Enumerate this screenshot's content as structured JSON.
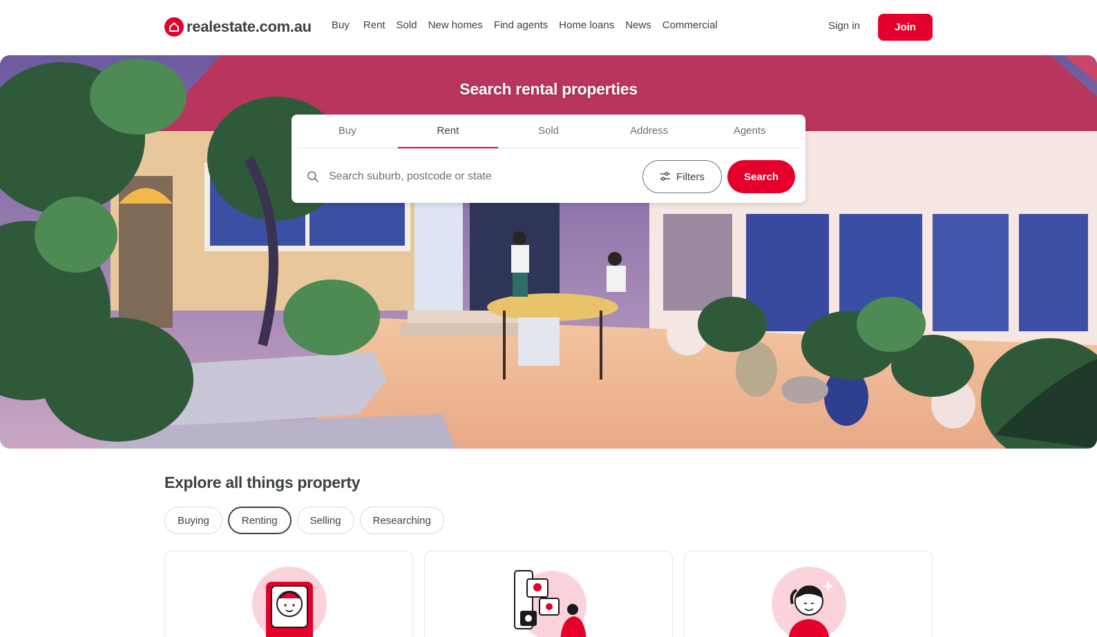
{
  "header": {
    "logo_text": "realestate.com.au",
    "nav": [
      "Buy",
      "Rent",
      "Sold",
      "New homes",
      "Find agents",
      "Home loans",
      "News",
      "Commercial"
    ],
    "sign_in": "Sign in",
    "join": "Join"
  },
  "hero": {
    "title": "Search rental properties"
  },
  "search": {
    "tabs": [
      "Buy",
      "Rent",
      "Sold",
      "Address",
      "Agents"
    ],
    "active_tab": "Rent",
    "placeholder": "Search suburb, postcode or state",
    "value": "",
    "filters_label": "Filters",
    "search_label": "Search"
  },
  "explore": {
    "title": "Explore all things property",
    "chips": [
      "Buying",
      "Renting",
      "Selling",
      "Researching"
    ],
    "active_chip": "Renting"
  },
  "icons": {
    "logo": "house-logo-icon",
    "search": "search-icon",
    "filters": "sliders-icon"
  },
  "colors": {
    "brand": "#e4002b",
    "text": "#3b4144",
    "muted": "#697074"
  }
}
